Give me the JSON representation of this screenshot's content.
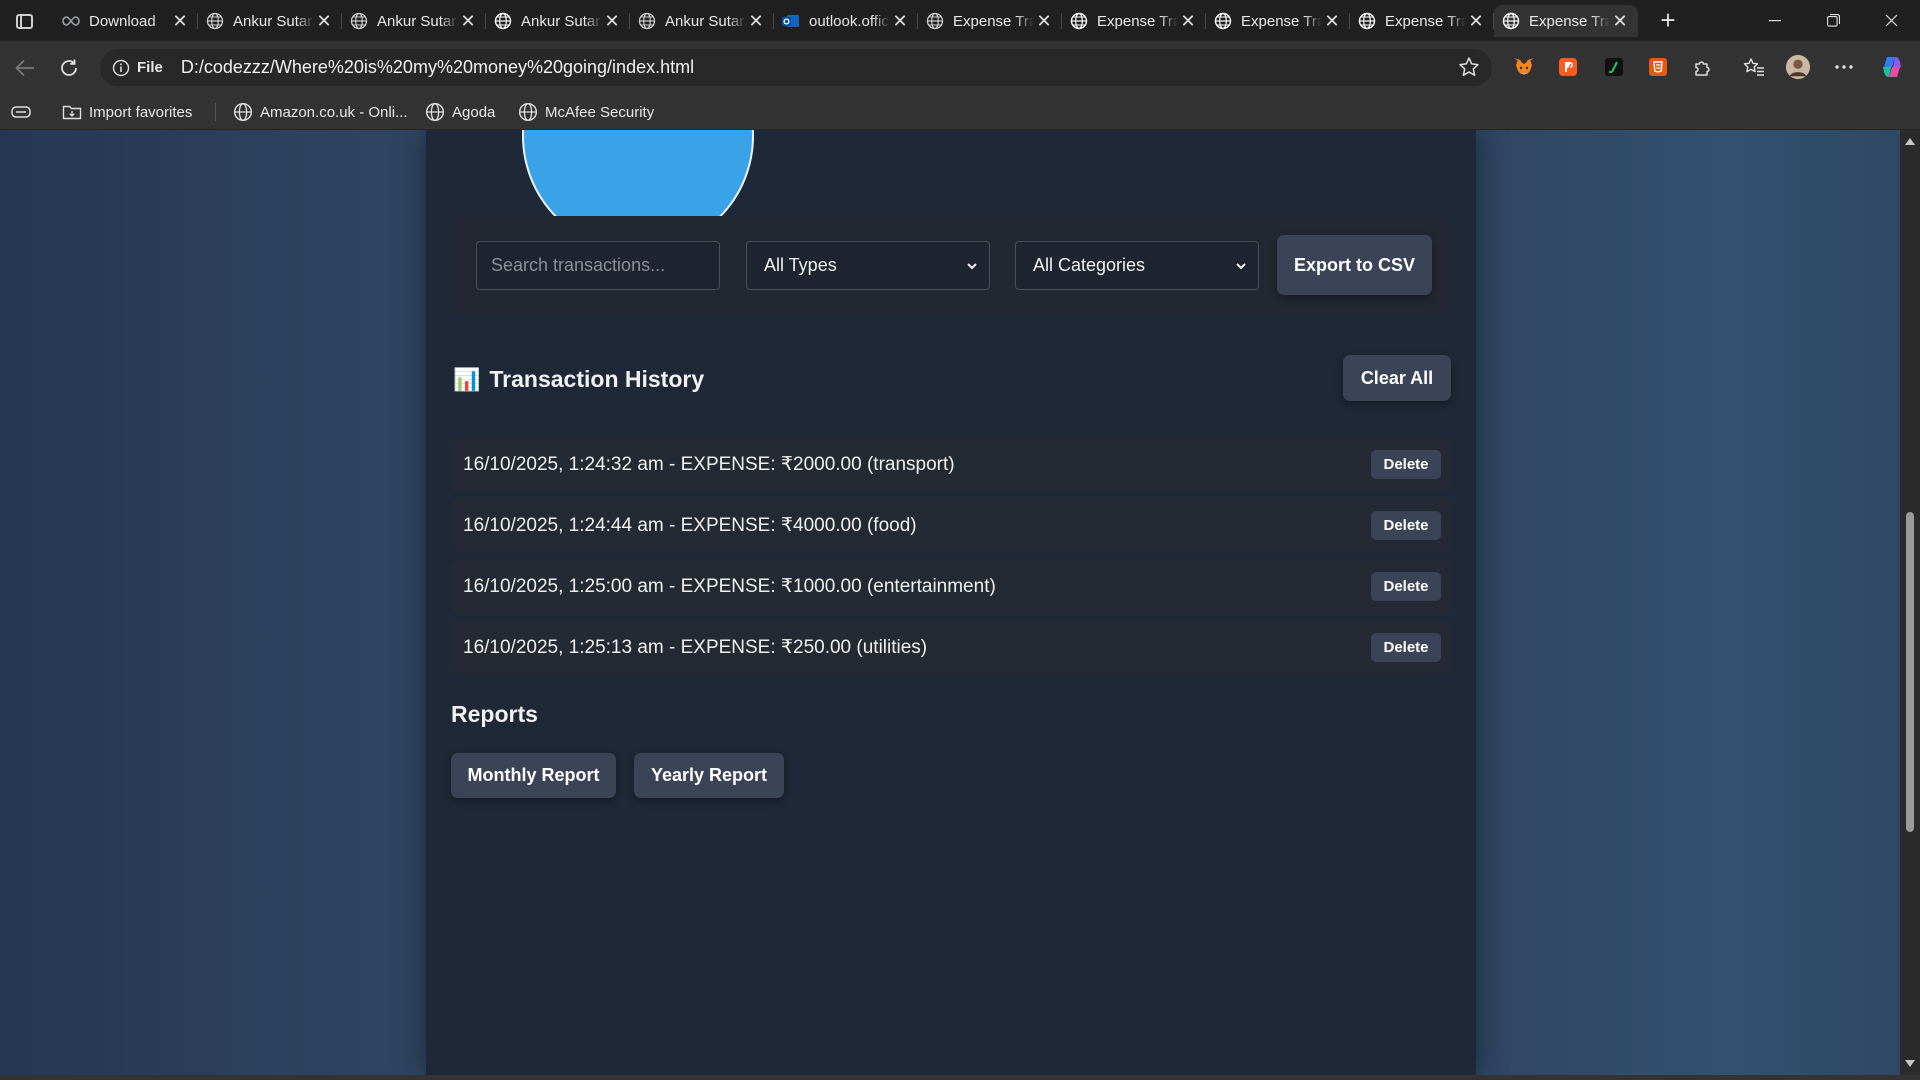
{
  "browser": {
    "tabs": [
      {
        "title": "Download",
        "favicon": "infinity-icon",
        "active": false
      },
      {
        "title": "Ankur Sutariya",
        "favicon": "globe-icon",
        "active": false
      },
      {
        "title": "Ankur Sutariya",
        "favicon": "globe-icon",
        "active": false
      },
      {
        "title": "Ankur Sutariya",
        "favicon": "globe-icon",
        "active": false
      },
      {
        "title": "Ankur Sutariya",
        "favicon": "globe-icon",
        "active": false
      },
      {
        "title": "outlook.office.com",
        "favicon": "outlook-icon",
        "active": false
      },
      {
        "title": "Expense Tracker",
        "favicon": "globe-icon",
        "active": false
      },
      {
        "title": "Expense Tracker",
        "favicon": "globe-icon",
        "active": false
      },
      {
        "title": "Expense Tracker",
        "favicon": "globe-icon",
        "active": false
      },
      {
        "title": "Expense Tracker",
        "favicon": "globe-icon",
        "active": false
      },
      {
        "title": "Expense Tracker",
        "favicon": "globe-icon",
        "active": true
      }
    ],
    "site_info_label": "File",
    "url": "D:/codezzz/Where%20is%20my%20money%20going/index.html",
    "bookmarks": {
      "import": "Import favorites",
      "amazon": "Amazon.co.uk - Onli...",
      "agoda": "Agoda",
      "mcafee": "McAfee Security"
    }
  },
  "app": {
    "search_placeholder": "Search transactions...",
    "type_filter": "All Types",
    "category_filter": "All Categories",
    "export_label": "Export to CSV",
    "history_icon": "📊",
    "history_title": "Transaction History",
    "clear_label": "Clear All",
    "transactions": [
      {
        "text": "16/10/2025, 1:24:32 am - EXPENSE: ₹2000.00 (transport)",
        "delete_label": "Delete"
      },
      {
        "text": "16/10/2025, 1:24:44 am - EXPENSE: ₹4000.00 (food)",
        "delete_label": "Delete"
      },
      {
        "text": "16/10/2025, 1:25:00 am - EXPENSE: ₹1000.00 (entertainment)",
        "delete_label": "Delete"
      },
      {
        "text": "16/10/2025, 1:25:13 am - EXPENSE: ₹250.00 (utilities)",
        "delete_label": "Delete"
      }
    ],
    "reports_title": "Reports",
    "monthly_label": "Monthly Report",
    "yearly_label": "Yearly Report"
  },
  "colors": {
    "pie_slice": "#3aa3e8",
    "button_bg": "#3b4356",
    "card_bg": "#1f2836"
  }
}
